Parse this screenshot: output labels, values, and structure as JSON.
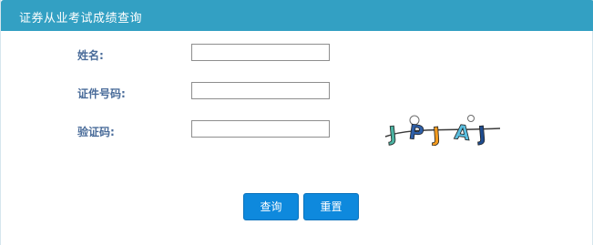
{
  "header": {
    "title": "证券从业考试成绩查询"
  },
  "form": {
    "name_label": "姓名:",
    "id_label": "证件号码:",
    "captcha_label": "验证码:",
    "name_value": "",
    "id_value": "",
    "captcha_value": "",
    "captcha_text": "JPJAJ"
  },
  "buttons": {
    "query": "查询",
    "reset": "重置"
  },
  "colors": {
    "header": "#33a0c3",
    "label": "#4a6c9a",
    "button": "#0e89dd"
  }
}
